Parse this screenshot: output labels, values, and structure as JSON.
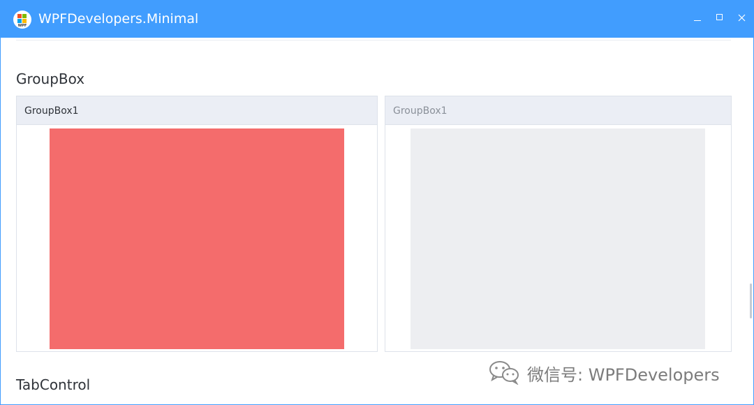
{
  "window": {
    "title": "WPFDevelopers.Minimal",
    "app_icon_label": "WPF",
    "accent": "#419DFE"
  },
  "sections": {
    "groupbox_title": "GroupBox",
    "tabcontrol_title": "TabControl"
  },
  "groupboxes": [
    {
      "header": "GroupBox1",
      "state": "enabled",
      "content_color": "#F46C6C"
    },
    {
      "header": "GroupBox1",
      "state": "disabled",
      "content_color": "#EDEEF1"
    }
  ],
  "watermark": {
    "text": "微信号: WPFDevelopers",
    "icon": "wechat-icon"
  },
  "icons": {
    "minimize": "minimize-icon",
    "maximize": "maximize-icon",
    "close": "close-icon"
  }
}
